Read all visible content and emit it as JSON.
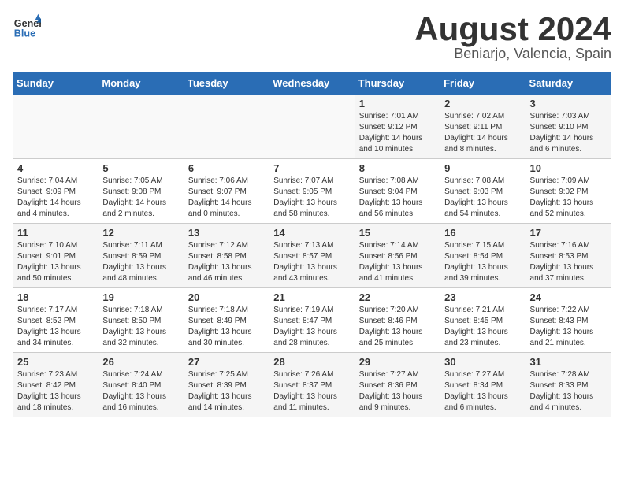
{
  "header": {
    "logo_general": "General",
    "logo_blue": "Blue",
    "main_title": "August 2024",
    "subtitle": "Beniarjo, Valencia, Spain"
  },
  "calendar": {
    "weekdays": [
      "Sunday",
      "Monday",
      "Tuesday",
      "Wednesday",
      "Thursday",
      "Friday",
      "Saturday"
    ],
    "weeks": [
      [
        {
          "day": "",
          "info": ""
        },
        {
          "day": "",
          "info": ""
        },
        {
          "day": "",
          "info": ""
        },
        {
          "day": "",
          "info": ""
        },
        {
          "day": "1",
          "info": "Sunrise: 7:01 AM\nSunset: 9:12 PM\nDaylight: 14 hours\nand 10 minutes."
        },
        {
          "day": "2",
          "info": "Sunrise: 7:02 AM\nSunset: 9:11 PM\nDaylight: 14 hours\nand 8 minutes."
        },
        {
          "day": "3",
          "info": "Sunrise: 7:03 AM\nSunset: 9:10 PM\nDaylight: 14 hours\nand 6 minutes."
        }
      ],
      [
        {
          "day": "4",
          "info": "Sunrise: 7:04 AM\nSunset: 9:09 PM\nDaylight: 14 hours\nand 4 minutes."
        },
        {
          "day": "5",
          "info": "Sunrise: 7:05 AM\nSunset: 9:08 PM\nDaylight: 14 hours\nand 2 minutes."
        },
        {
          "day": "6",
          "info": "Sunrise: 7:06 AM\nSunset: 9:07 PM\nDaylight: 14 hours\nand 0 minutes."
        },
        {
          "day": "7",
          "info": "Sunrise: 7:07 AM\nSunset: 9:05 PM\nDaylight: 13 hours\nand 58 minutes."
        },
        {
          "day": "8",
          "info": "Sunrise: 7:08 AM\nSunset: 9:04 PM\nDaylight: 13 hours\nand 56 minutes."
        },
        {
          "day": "9",
          "info": "Sunrise: 7:08 AM\nSunset: 9:03 PM\nDaylight: 13 hours\nand 54 minutes."
        },
        {
          "day": "10",
          "info": "Sunrise: 7:09 AM\nSunset: 9:02 PM\nDaylight: 13 hours\nand 52 minutes."
        }
      ],
      [
        {
          "day": "11",
          "info": "Sunrise: 7:10 AM\nSunset: 9:01 PM\nDaylight: 13 hours\nand 50 minutes."
        },
        {
          "day": "12",
          "info": "Sunrise: 7:11 AM\nSunset: 8:59 PM\nDaylight: 13 hours\nand 48 minutes."
        },
        {
          "day": "13",
          "info": "Sunrise: 7:12 AM\nSunset: 8:58 PM\nDaylight: 13 hours\nand 46 minutes."
        },
        {
          "day": "14",
          "info": "Sunrise: 7:13 AM\nSunset: 8:57 PM\nDaylight: 13 hours\nand 43 minutes."
        },
        {
          "day": "15",
          "info": "Sunrise: 7:14 AM\nSunset: 8:56 PM\nDaylight: 13 hours\nand 41 minutes."
        },
        {
          "day": "16",
          "info": "Sunrise: 7:15 AM\nSunset: 8:54 PM\nDaylight: 13 hours\nand 39 minutes."
        },
        {
          "day": "17",
          "info": "Sunrise: 7:16 AM\nSunset: 8:53 PM\nDaylight: 13 hours\nand 37 minutes."
        }
      ],
      [
        {
          "day": "18",
          "info": "Sunrise: 7:17 AM\nSunset: 8:52 PM\nDaylight: 13 hours\nand 34 minutes."
        },
        {
          "day": "19",
          "info": "Sunrise: 7:18 AM\nSunset: 8:50 PM\nDaylight: 13 hours\nand 32 minutes."
        },
        {
          "day": "20",
          "info": "Sunrise: 7:18 AM\nSunset: 8:49 PM\nDaylight: 13 hours\nand 30 minutes."
        },
        {
          "day": "21",
          "info": "Sunrise: 7:19 AM\nSunset: 8:47 PM\nDaylight: 13 hours\nand 28 minutes."
        },
        {
          "day": "22",
          "info": "Sunrise: 7:20 AM\nSunset: 8:46 PM\nDaylight: 13 hours\nand 25 minutes."
        },
        {
          "day": "23",
          "info": "Sunrise: 7:21 AM\nSunset: 8:45 PM\nDaylight: 13 hours\nand 23 minutes."
        },
        {
          "day": "24",
          "info": "Sunrise: 7:22 AM\nSunset: 8:43 PM\nDaylight: 13 hours\nand 21 minutes."
        }
      ],
      [
        {
          "day": "25",
          "info": "Sunrise: 7:23 AM\nSunset: 8:42 PM\nDaylight: 13 hours\nand 18 minutes."
        },
        {
          "day": "26",
          "info": "Sunrise: 7:24 AM\nSunset: 8:40 PM\nDaylight: 13 hours\nand 16 minutes."
        },
        {
          "day": "27",
          "info": "Sunrise: 7:25 AM\nSunset: 8:39 PM\nDaylight: 13 hours\nand 14 minutes."
        },
        {
          "day": "28",
          "info": "Sunrise: 7:26 AM\nSunset: 8:37 PM\nDaylight: 13 hours\nand 11 minutes."
        },
        {
          "day": "29",
          "info": "Sunrise: 7:27 AM\nSunset: 8:36 PM\nDaylight: 13 hours\nand 9 minutes."
        },
        {
          "day": "30",
          "info": "Sunrise: 7:27 AM\nSunset: 8:34 PM\nDaylight: 13 hours\nand 6 minutes."
        },
        {
          "day": "31",
          "info": "Sunrise: 7:28 AM\nSunset: 8:33 PM\nDaylight: 13 hours\nand 4 minutes."
        }
      ]
    ]
  }
}
